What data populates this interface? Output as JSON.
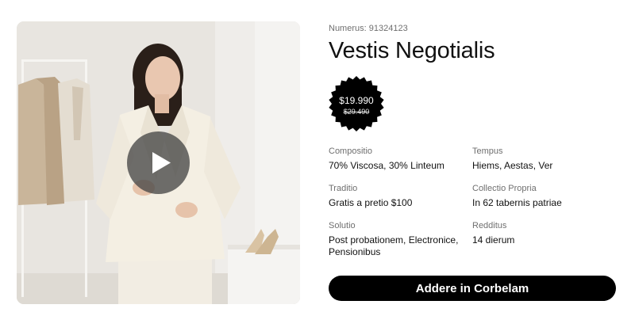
{
  "product": {
    "sku_label": "Numerus:",
    "sku_value": "91324123",
    "title": "Vestis Negotialis"
  },
  "price": {
    "current": "$19.990",
    "original": "$29.490"
  },
  "specs": [
    {
      "label": "Compositio",
      "value": "70% Viscosa, 30% Linteum"
    },
    {
      "label": "Tempus",
      "value": "Hiems, Aestas, Ver"
    },
    {
      "label": "Traditio",
      "value": "Gratis a pretio $100"
    },
    {
      "label": "Collectio Propria",
      "value": "In 62 tabernis patriae"
    },
    {
      "label": "Solutio",
      "value": "Post probationem, Electronice, Pensionibus"
    },
    {
      "label": "Redditus",
      "value": "14 dierum"
    }
  ],
  "cart": {
    "button_label": "Addere in Corbelam"
  },
  "colors": {
    "button_bg": "#000000",
    "badge_bg": "#000000",
    "label_gray": "#6f6f6f"
  },
  "icons": {
    "play": "play-icon",
    "badge": "starburst-badge"
  }
}
